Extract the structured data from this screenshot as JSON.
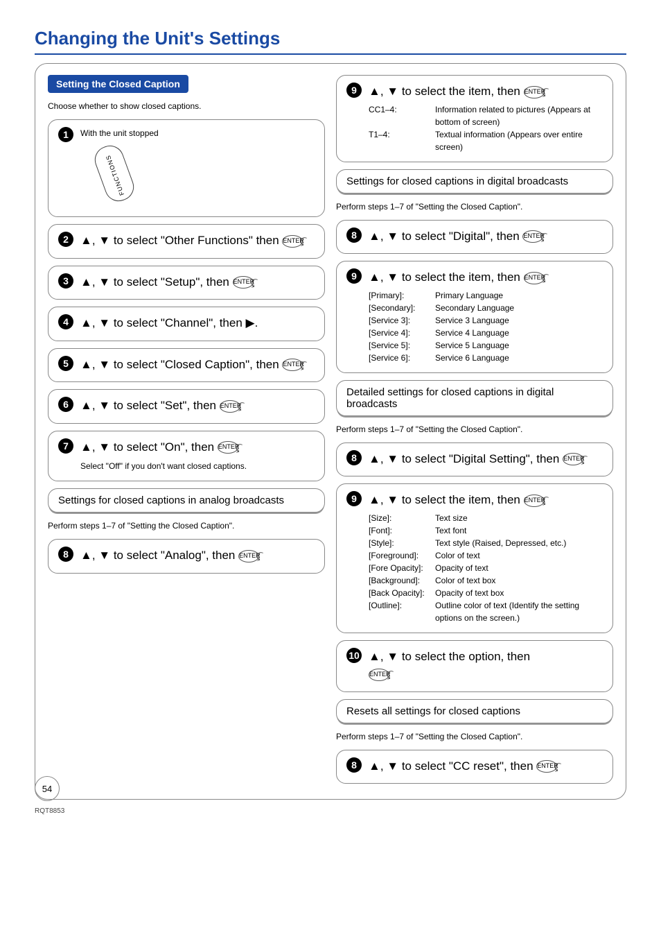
{
  "title": "Changing the Unit's Settings",
  "section_header": "Setting the Closed Caption",
  "intro": "Choose whether to show closed captions.",
  "step1_label": "With the unit stopped",
  "functions_label": "FUNCTIONS",
  "step2": "▲, ▼ to select \"Other Functions\" then",
  "step3": "▲, ▼ to select \"Setup\", then",
  "step4": "▲, ▼ to select \"Channel\", then ▶.",
  "step5": "▲, ▼ to select \"Closed Caption\", then",
  "step6": "▲, ▼ to select \"Set\", then",
  "step7_a": "▲, ▼ to select \"On\", then",
  "step7_note": "Select \"Off\" if you don't want closed captions.",
  "analog_header": "Settings for closed captions in analog broadcasts",
  "analog_note": "Perform steps 1–7 of \"Setting the Closed Caption\".",
  "step8_analog": "▲, ▼ to select \"Analog\", then",
  "step9_item": "▲, ▼ to select the item, then",
  "cc14_key": "CC1–4:",
  "cc14_val": "Information related to pictures (Appears at bottom of screen)",
  "t14_key": "T1–4:",
  "t14_val": "Textual information (Appears over entire screen)",
  "digital_header": "Settings for closed captions in digital broadcasts",
  "digital_note": "Perform steps 1–7 of \"Setting the Closed Caption\".",
  "step8_digital": "▲, ▼ to select \"Digital\", then",
  "step9_digital": "▲, ▼ to select the item, then",
  "lang_rows": [
    {
      "k": "[Primary]:",
      "v": "Primary Language"
    },
    {
      "k": "[Secondary]:",
      "v": "Secondary Language"
    },
    {
      "k": "[Service 3]:",
      "v": "Service 3 Language"
    },
    {
      "k": "[Service 4]:",
      "v": "Service 4 Language"
    },
    {
      "k": "[Service 5]:",
      "v": "Service 5 Language"
    },
    {
      "k": "[Service 6]:",
      "v": "Service 6 Language"
    }
  ],
  "detailed_header": "Detailed settings for closed captions in digital broadcasts",
  "detailed_note": "Perform steps 1–7 of \"Setting the Closed Caption\".",
  "step8_ds": "▲, ▼ to select \"Digital Setting\", then",
  "step9_ds": "▲, ▼ to select the item, then",
  "ds_rows": [
    {
      "k": "[Size]:",
      "v": "Text size"
    },
    {
      "k": "[Font]:",
      "v": "Text font"
    },
    {
      "k": "[Style]:",
      "v": "Text style (Raised, Depressed, etc.)"
    },
    {
      "k": "[Foreground]:",
      "v": "Color of text"
    },
    {
      "k": "[Fore Opacity]:",
      "v": "Opacity of text"
    },
    {
      "k": "[Background]:",
      "v": "Color of text box"
    },
    {
      "k": "[Back Opacity]:",
      "v": "Opacity of text box"
    },
    {
      "k": "[Outline]:",
      "v": "Outline color of text (Identify the setting options on the screen.)"
    }
  ],
  "step10": "▲, ▼ to select the option, then",
  "reset_header": "Resets all settings for closed captions",
  "reset_note": "Perform steps 1–7 of \"Setting the Closed Caption\".",
  "step8_reset": "▲, ▼ to select \"CC reset\", then",
  "enter_label": "ENTER",
  "page_num": "54",
  "model": "RQT8853"
}
